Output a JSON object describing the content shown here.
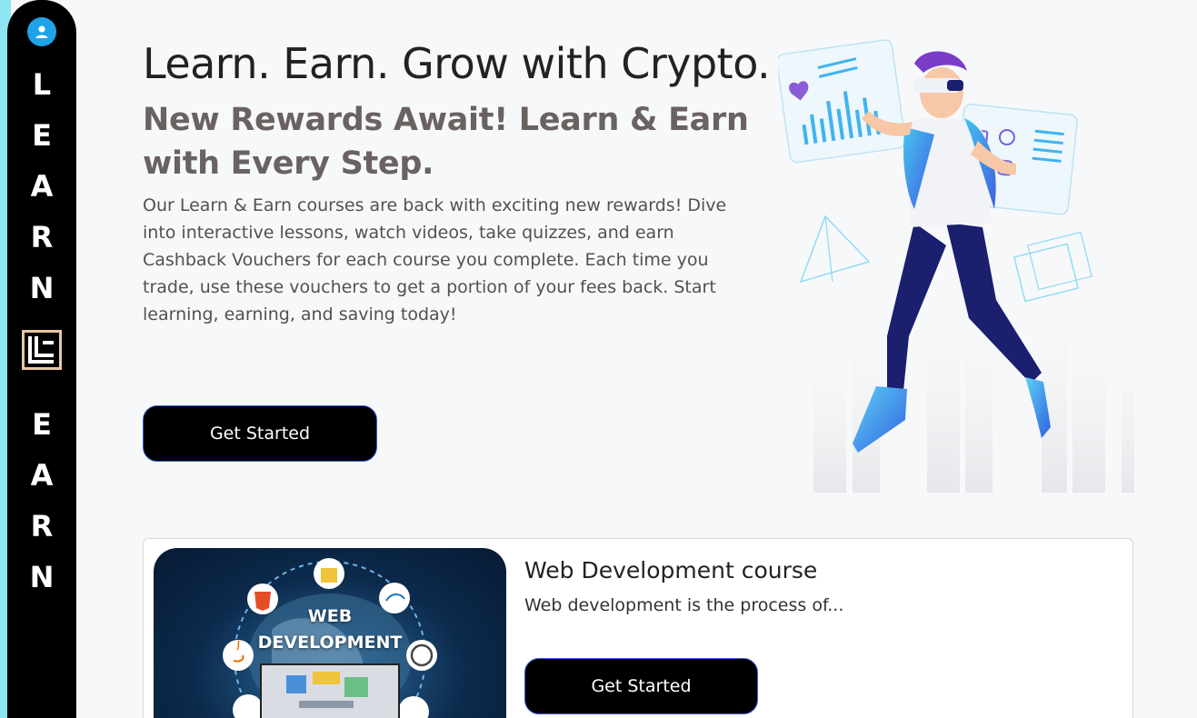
{
  "sidebar": {
    "letters_top": [
      "L",
      "E",
      "A",
      "R",
      "N"
    ],
    "letters_bottom": [
      "E",
      "A",
      "R",
      "N"
    ],
    "avatar_icon": "user-icon",
    "logo_icon": "brand-logo-icon"
  },
  "hero": {
    "title": "Learn. Earn. Grow with Crypto.",
    "subtitle": "New Rewards Await! Learn & Earn with Every Step.",
    "description": "Our Learn & Earn courses are back with exciting new rewards! Dive into interactive lessons, watch videos, take quizzes, and earn Cashback Vouchers for each course you complete. Each time you trade, use these vouchers to get a portion of your fees back. Start learning, earning, and saving today!",
    "cta_label": "Get Started"
  },
  "course": {
    "title": "Web Development course",
    "description": "Web development is the process of...",
    "cta_label": "Get Started",
    "thumb_line1": "WEB",
    "thumb_line2": "DEVELOPMENT",
    "thumb_badges": [
      "JS",
      "HTML",
      "jQuery",
      "WordPress",
      "Java"
    ]
  },
  "colors": {
    "background": "#f7f8fa",
    "sidebar": "#000000",
    "accent_blue": "#1fa3e8",
    "button_border": "#3a5dd8"
  }
}
